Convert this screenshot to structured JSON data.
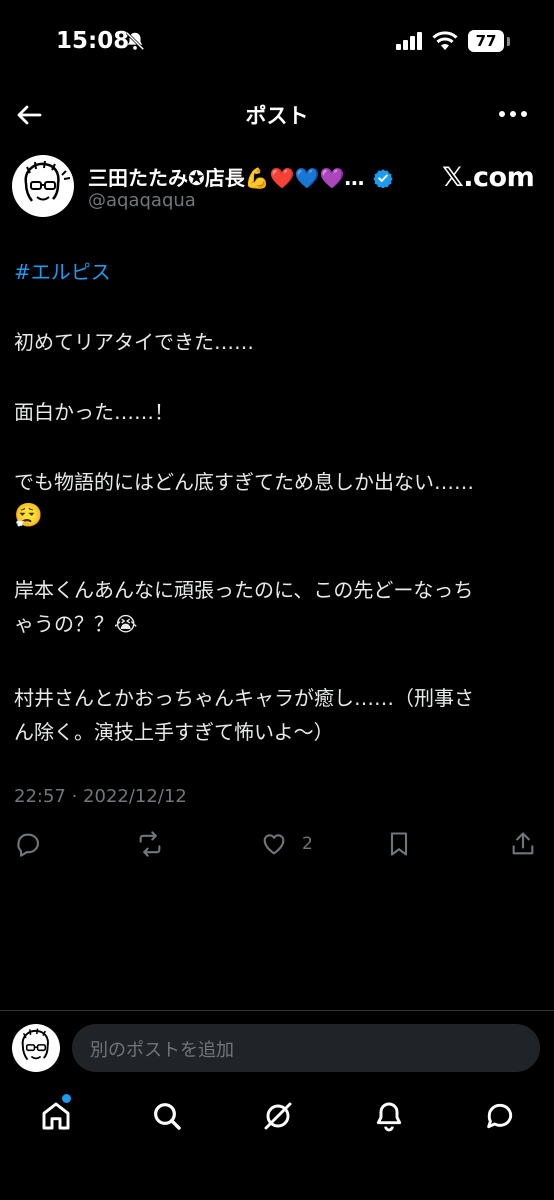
{
  "status_bar": {
    "time": "15:08",
    "battery": "77"
  },
  "header": {
    "title": "ポスト"
  },
  "author": {
    "display_name": "三田たたみ✪店長💪❤️💙💜…",
    "handle": "@aqaqaqua"
  },
  "brand": {
    "label": "𝕏.com"
  },
  "post": {
    "hashtag": "#エルピス",
    "lines": [
      "初めてリアタイできた……",
      "面白かった……！",
      "でも物語的にはどん底すぎてため息しか出ない……",
      "😮‍💨",
      "岸本くんあんなに頑張ったのに、この先どーなっち",
      "ゃうの？？😭",
      "村井さんとかおっちゃんキャラが癒し……（刑事さ",
      "ん除く。演技上手すぎて怖いよ〜）"
    ],
    "timestamp": "22:57 · 2022/12/12",
    "like_count": "2"
  },
  "reply": {
    "placeholder": "別のポストを追加"
  },
  "colors": {
    "accent": "#1d9bf0",
    "muted": "#71767b",
    "background": "#000000"
  },
  "icons": [
    "back-arrow-icon",
    "more-icon",
    "verified-icon",
    "reply-icon",
    "repost-icon",
    "like-icon",
    "bookmark-icon",
    "share-icon",
    "home-icon",
    "search-icon",
    "grok-icon",
    "notifications-icon",
    "messages-icon"
  ]
}
